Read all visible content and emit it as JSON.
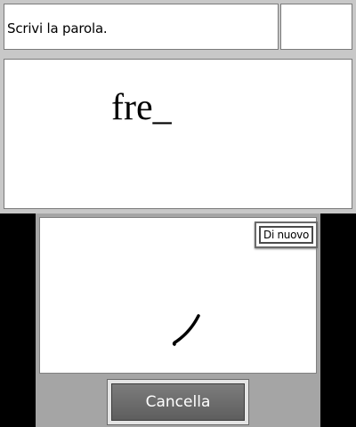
{
  "top_screen": {
    "instruction": "Scrivi la parola.",
    "counter": "",
    "word_prompt": "fre_"
  },
  "bottom_screen": {
    "retry_button_label": "Di nuovo",
    "cancel_button_label": "Cancella",
    "handwriting_stroke": "short curved pen stroke"
  },
  "colors": {
    "frame_gray": "#c8c8c8",
    "touch_gray": "#a5a5a5",
    "cancel_button": "#6e6e6e",
    "screen_border": "#000000"
  }
}
